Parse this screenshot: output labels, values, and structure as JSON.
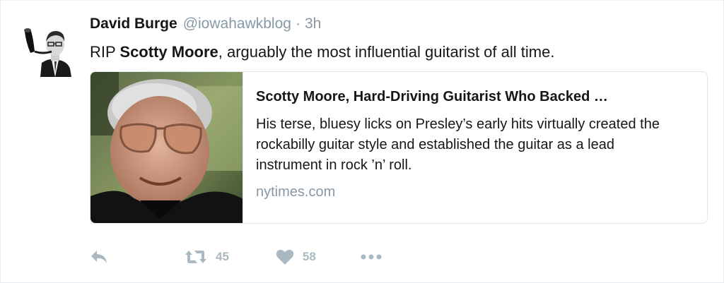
{
  "tweet": {
    "author": {
      "name": "David Burge",
      "handle": "@iowahawkblog",
      "separator": "·",
      "time": "3h",
      "avatar_icon": "avatar-pipe-smoker"
    },
    "text_prefix": "RIP ",
    "text_mention": "Scotty Moore",
    "text_suffix": ", arguably the most influential guitarist of all time."
  },
  "card": {
    "title": "Scotty Moore, Hard-Driving Guitarist Who Backed …",
    "description": "His terse, bluesy licks on Presley’s early hits virtually created the rockabilly guitar style and established the guitar as a lead instrument in rock ’n’ roll.",
    "domain": "nytimes.com",
    "image_icon": "portrait-photo"
  },
  "actions": {
    "reply_icon": "reply-icon",
    "retweet_icon": "retweet-icon",
    "retweet_count": "45",
    "like_icon": "heart-icon",
    "like_count": "58",
    "more_icon": "more-icon"
  },
  "colors": {
    "text": "#14171a",
    "secondary": "#8899a6",
    "action_gray": "#aab8c2",
    "border": "#e1e8ed"
  }
}
